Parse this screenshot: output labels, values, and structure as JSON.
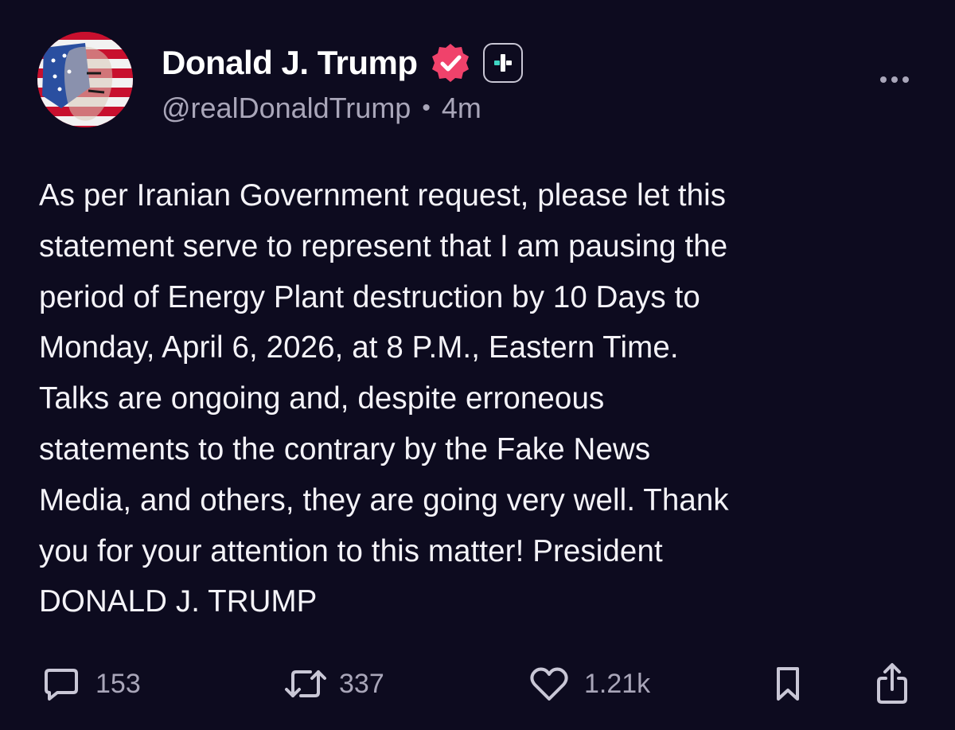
{
  "author": {
    "display_name": "Donald J. Trump",
    "handle": "@realDonaldTrump",
    "separator": "•",
    "time_ago": "4m",
    "verified_color": "#f0426b",
    "follow_icon": "plus-icon",
    "follow_icon_colors": [
      "#3fd6c3",
      "#ffffff"
    ]
  },
  "post": {
    "text": "As per Iranian Government request, please let this\nstatement serve to represent that I am pausing the\nperiod of Energy Plant destruction by 10 Days to\nMonday, April 6, 2026, at 8 P.M., Eastern Time.\nTalks are ongoing and, despite erroneous\nstatements to the contrary by the Fake News\nMedia, and others, they are going very well. Thank\nyou for your attention to this matter! President\nDONALD J. TRUMP"
  },
  "actions": {
    "replies": {
      "icon": "comment-icon",
      "count": "153"
    },
    "retruths": {
      "icon": "repost-icon",
      "count": "337"
    },
    "likes": {
      "icon": "heart-icon",
      "count": "1.21k"
    },
    "bookmark": {
      "icon": "bookmark-icon"
    },
    "share": {
      "icon": "share-icon"
    }
  },
  "theme": {
    "background": "#0d0b1f",
    "text": "#f4f3f8",
    "muted": "#a9a6b9"
  }
}
